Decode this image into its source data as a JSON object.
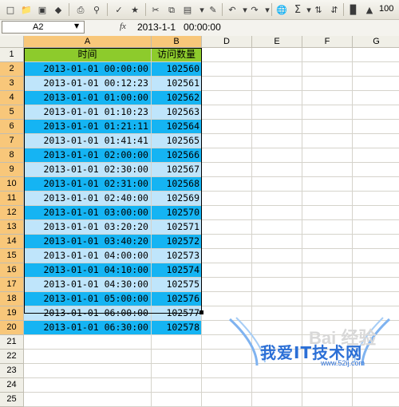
{
  "toolbar": {
    "icons": [
      "new-icon",
      "open-icon",
      "save-icon",
      "permission-icon",
      "print-icon",
      "print-preview-icon",
      "spelling-icon",
      "research-icon",
      "cut-icon",
      "copy-icon",
      "paste-icon",
      "format-painter-icon",
      "undo-icon",
      "redo-icon",
      "hyperlink-icon",
      "autosum-icon",
      "sort-ascending-icon",
      "sort-descending-icon",
      "chart-wizard-icon",
      "drawing-icon"
    ],
    "autosum_glyph": "Σ",
    "zoom": "100"
  },
  "formula_bar": {
    "name_box": "A2",
    "fx": "fx",
    "value": "2013-1-1   00:00:00"
  },
  "columns": [
    "A",
    "B",
    "D",
    "E",
    "F",
    "G"
  ],
  "header_row": {
    "a": "时间",
    "b": "访问数量"
  },
  "rows": [
    {
      "n": "1"
    },
    {
      "n": "2",
      "time": "2013-01-01 00:00:00",
      "count": "102560"
    },
    {
      "n": "3",
      "time": "2013-01-01 00:12:23",
      "count": "102561"
    },
    {
      "n": "4",
      "time": "2013-01-01 01:00:00",
      "count": "102562"
    },
    {
      "n": "5",
      "time": "2013-01-01 01:10:23",
      "count": "102563"
    },
    {
      "n": "6",
      "time": "2013-01-01 01:21:11",
      "count": "102564"
    },
    {
      "n": "7",
      "time": "2013-01-01 01:41:41",
      "count": "102565"
    },
    {
      "n": "8",
      "time": "2013-01-01 02:00:00",
      "count": "102566"
    },
    {
      "n": "9",
      "time": "2013-01-01 02:30:00",
      "count": "102567"
    },
    {
      "n": "10",
      "time": "2013-01-01 02:31:00",
      "count": "102568"
    },
    {
      "n": "11",
      "time": "2013-01-01 02:40:00",
      "count": "102569"
    },
    {
      "n": "12",
      "time": "2013-01-01 03:00:00",
      "count": "102570"
    },
    {
      "n": "13",
      "time": "2013-01-01 03:20:20",
      "count": "102571"
    },
    {
      "n": "14",
      "time": "2013-01-01 03:40:20",
      "count": "102572"
    },
    {
      "n": "15",
      "time": "2013-01-01 04:00:00",
      "count": "102573"
    },
    {
      "n": "16",
      "time": "2013-01-01 04:10:00",
      "count": "102574"
    },
    {
      "n": "17",
      "time": "2013-01-01 04:30:00",
      "count": "102575"
    },
    {
      "n": "18",
      "time": "2013-01-01 05:00:00",
      "count": "102576"
    },
    {
      "n": "19",
      "time": "2013-01-01 06:00:00",
      "count": "102577"
    },
    {
      "n": "20",
      "time": "2013-01-01 06:30:00",
      "count": "102578"
    },
    {
      "n": "21"
    },
    {
      "n": "22"
    },
    {
      "n": "23"
    },
    {
      "n": "24"
    },
    {
      "n": "25"
    }
  ],
  "watermark": {
    "baidu": "Bai 经验",
    "brand": "我爱IT技术网",
    "url": "www.52ij.com"
  },
  "colors": {
    "header_fill": "#8dcb2c",
    "row_dark": "#15b4f3",
    "row_light": "#bfe5fb",
    "selected_header": "#f8c77a"
  }
}
